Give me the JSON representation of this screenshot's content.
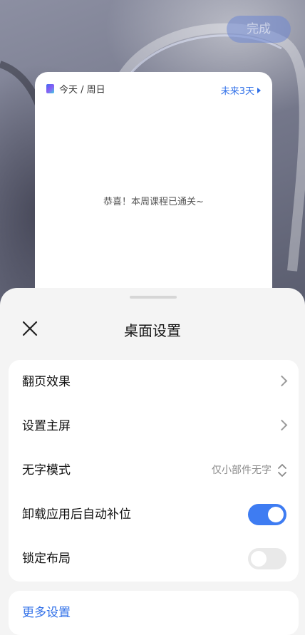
{
  "topbar": {
    "done_label": "完成"
  },
  "widget": {
    "date_label": "今天 / 周日",
    "more_label": "未来3天",
    "message": "恭喜！本周课程已通关~"
  },
  "sheet": {
    "title": "桌面设置",
    "rows": [
      {
        "label": "翻页效果",
        "control": "chevron"
      },
      {
        "label": "设置主屏",
        "control": "chevron"
      },
      {
        "label": "无字模式",
        "control": "select",
        "value": "仅小部件无字"
      },
      {
        "label": "卸载应用后自动补位",
        "control": "toggle",
        "on": true
      },
      {
        "label": "锁定布局",
        "control": "toggle",
        "on": false
      }
    ],
    "more_settings": "更多设置"
  },
  "colors": {
    "accent": "#3e7cf2",
    "link": "#2f6fe8",
    "sheet_bg": "#f4f4f4"
  }
}
